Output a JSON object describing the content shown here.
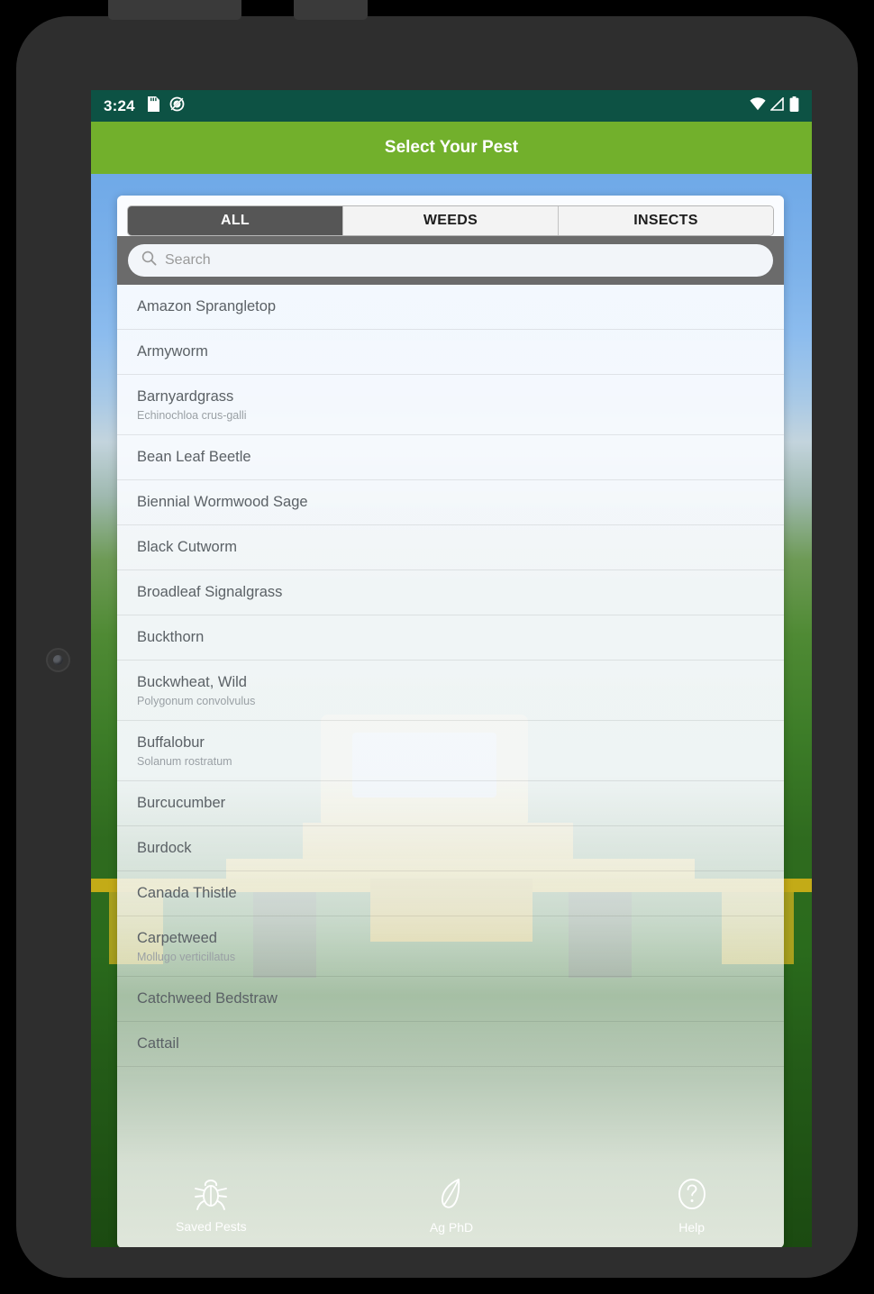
{
  "status_bar": {
    "time": "3:24",
    "left_icons": [
      "sd-card-icon",
      "do-not-disturb-icon"
    ],
    "right_icons": [
      "wifi-icon",
      "cell-signal-icon",
      "battery-icon"
    ],
    "background_color": "#0d5244"
  },
  "app_bar": {
    "title": "Select Your Pest",
    "background_color": "#72b02c"
  },
  "tabs": [
    {
      "label": "ALL",
      "active": true
    },
    {
      "label": "WEEDS",
      "active": false
    },
    {
      "label": "INSECTS",
      "active": false
    }
  ],
  "search": {
    "placeholder": "Search",
    "value": "",
    "icon": "search-icon"
  },
  "pest_list": [
    {
      "name": "Amazon Sprangletop",
      "scientific": ""
    },
    {
      "name": "Armyworm",
      "scientific": ""
    },
    {
      "name": "Barnyardgrass",
      "scientific": "Echinochloa crus-galli"
    },
    {
      "name": "Bean Leaf Beetle",
      "scientific": ""
    },
    {
      "name": "Biennial Wormwood Sage",
      "scientific": ""
    },
    {
      "name": "Black Cutworm",
      "scientific": ""
    },
    {
      "name": "Broadleaf Signalgrass",
      "scientific": ""
    },
    {
      "name": "Buckthorn",
      "scientific": ""
    },
    {
      "name": "Buckwheat, Wild",
      "scientific": "Polygonum convolvulus"
    },
    {
      "name": "Buffalobur",
      "scientific": "Solanum rostratum"
    },
    {
      "name": "Burcucumber",
      "scientific": ""
    },
    {
      "name": "Burdock",
      "scientific": ""
    },
    {
      "name": "Canada Thistle",
      "scientific": ""
    },
    {
      "name": "Carpetweed",
      "scientific": "Mollugo verticillatus"
    },
    {
      "name": "Catchweed Bedstraw",
      "scientific": ""
    },
    {
      "name": "Cattail",
      "scientific": ""
    }
  ],
  "bottom_nav": [
    {
      "label": "Saved Pests",
      "icon": "bug-icon"
    },
    {
      "label": "Ag PhD",
      "icon": "leaf-icon"
    },
    {
      "label": "Help",
      "icon": "question-circle-icon"
    }
  ],
  "android_nav": [
    {
      "name": "back-button",
      "icon": "triangle-left-icon"
    },
    {
      "name": "home-button",
      "icon": "circle-icon"
    },
    {
      "name": "recents-button",
      "icon": "square-icon"
    }
  ],
  "colors": {
    "accent_green": "#72b02c",
    "status_green": "#0d5244",
    "tab_active": "#565656",
    "search_band": "#6b6b6b"
  }
}
